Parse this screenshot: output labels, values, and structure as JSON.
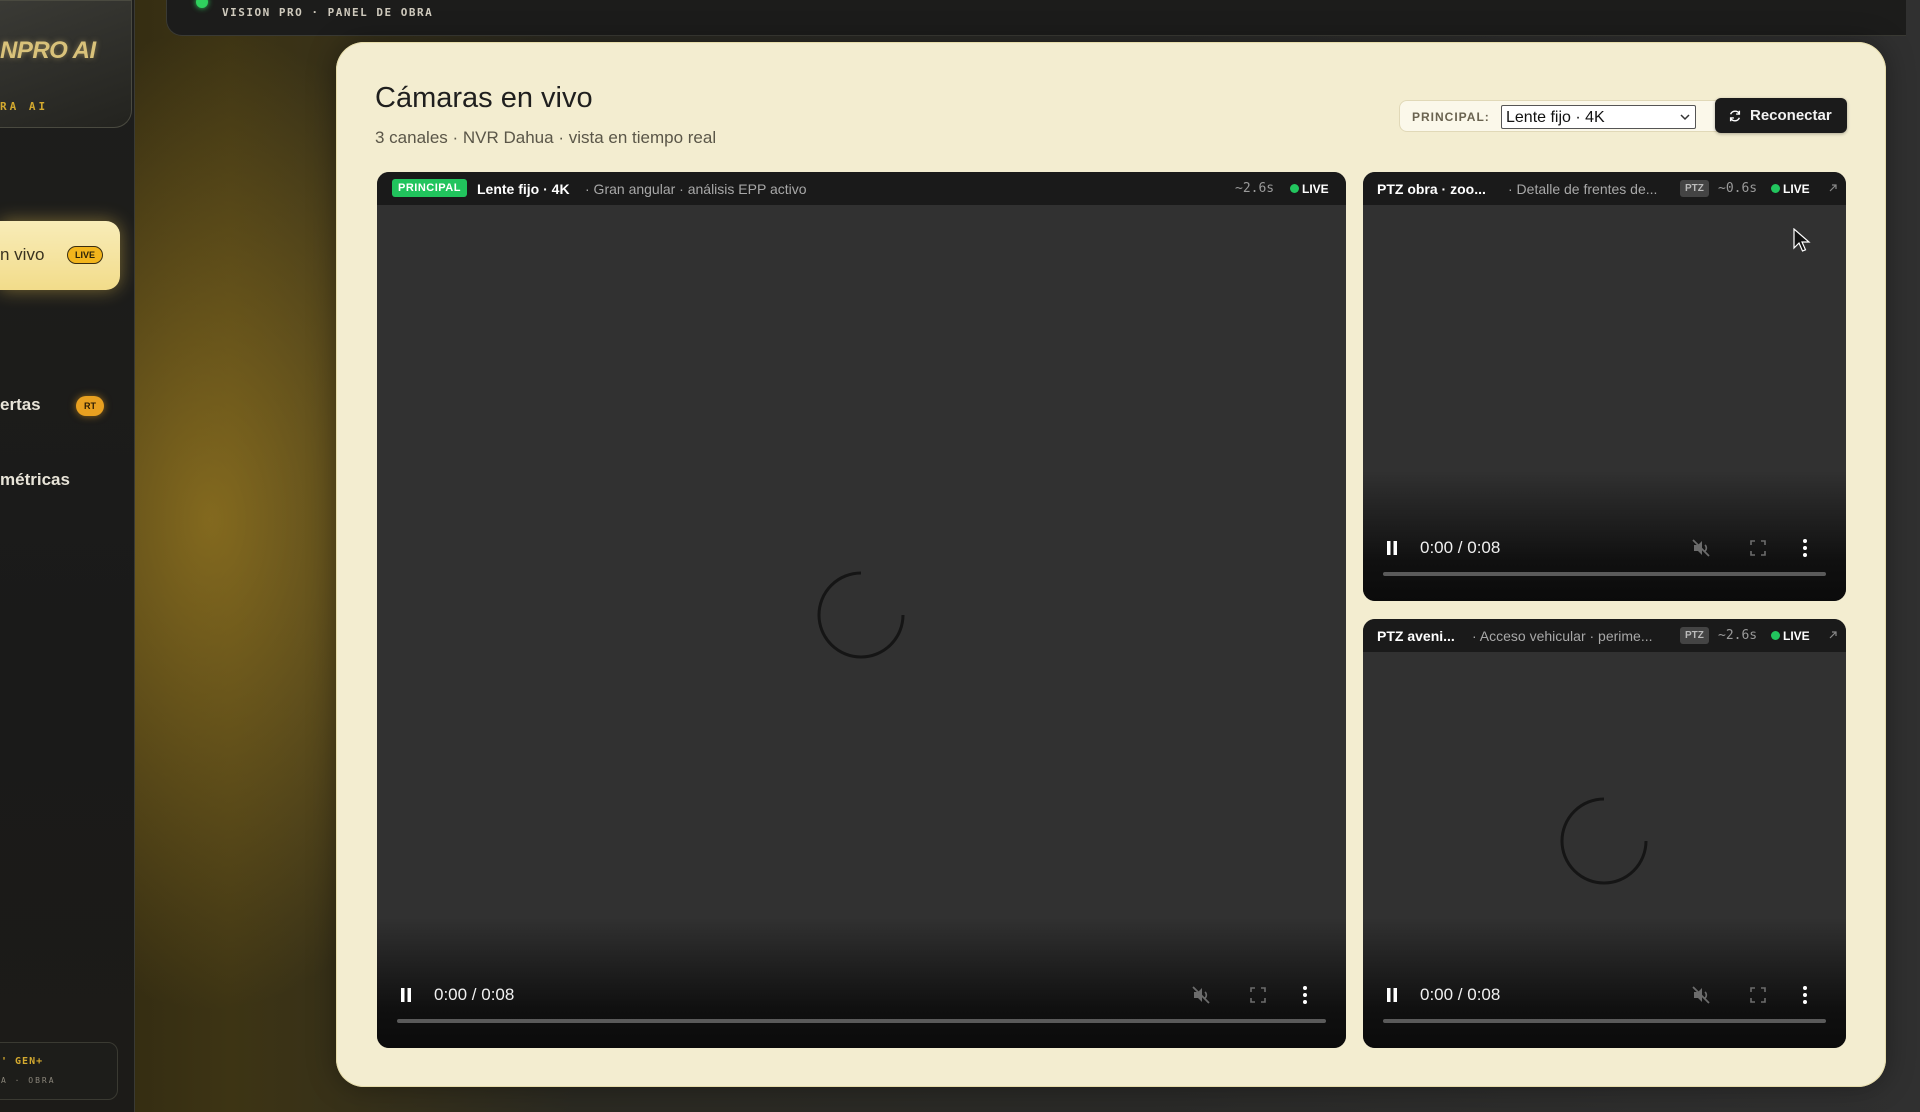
{
  "brand": {
    "logo": "NPRO AI",
    "subtitle": "RA AI"
  },
  "nav": {
    "live_label": "n vivo",
    "live_badge": "LIVE",
    "alertas_label": "ertas",
    "alertas_badge": "RT",
    "metricas_label": "métricas"
  },
  "footer": {
    "line1": "' GEN+",
    "line2": "A · OBRA"
  },
  "topbar": {
    "title": "VISION PRO · PANEL DE OBRA"
  },
  "page": {
    "title": "Cámaras en vivo",
    "subtitle": "3 canales · NVR Dahua · vista en tiempo real"
  },
  "principal_selector": {
    "label": "PRINCIPAL:",
    "selected": "Lente fijo · 4K",
    "options": [
      "Lente fijo · 4K"
    ]
  },
  "reconnect_button": {
    "label": "Reconectar"
  },
  "colors": {
    "accent": "#f2b51c",
    "live": "#22c55e",
    "panel_bg": "#f3edd0",
    "video_bg": "#313131"
  },
  "cameras": [
    {
      "tag": "PRINCIPAL",
      "name": "Lente fijo · 4K",
      "desc": "· Gran angular · análisis EPP activo",
      "latency": "~2.6s",
      "live": "LIVE",
      "time": "0:00 / 0:08",
      "progress": 0,
      "loading": true
    },
    {
      "name": "PTZ obra · zoo...",
      "desc": "· Detalle de frentes de...",
      "type": "PTZ",
      "latency": "~0.6s",
      "live": "LIVE",
      "time": "0:00 / 0:08",
      "progress": 0,
      "loading": false
    },
    {
      "name": "PTZ aveni...",
      "desc": "· Acceso vehicular · perime...",
      "type": "PTZ",
      "latency": "~2.6s",
      "live": "LIVE",
      "time": "0:00 / 0:08",
      "progress": 0,
      "loading": true
    }
  ],
  "icons": {
    "pause": "pause-icon",
    "mute": "volume-mute-icon",
    "fullscreen": "fullscreen-icon",
    "more": "more-vertical-icon",
    "refresh": "refresh-icon",
    "expand": "expand-icon",
    "spinner": "loading-spinner-icon"
  }
}
